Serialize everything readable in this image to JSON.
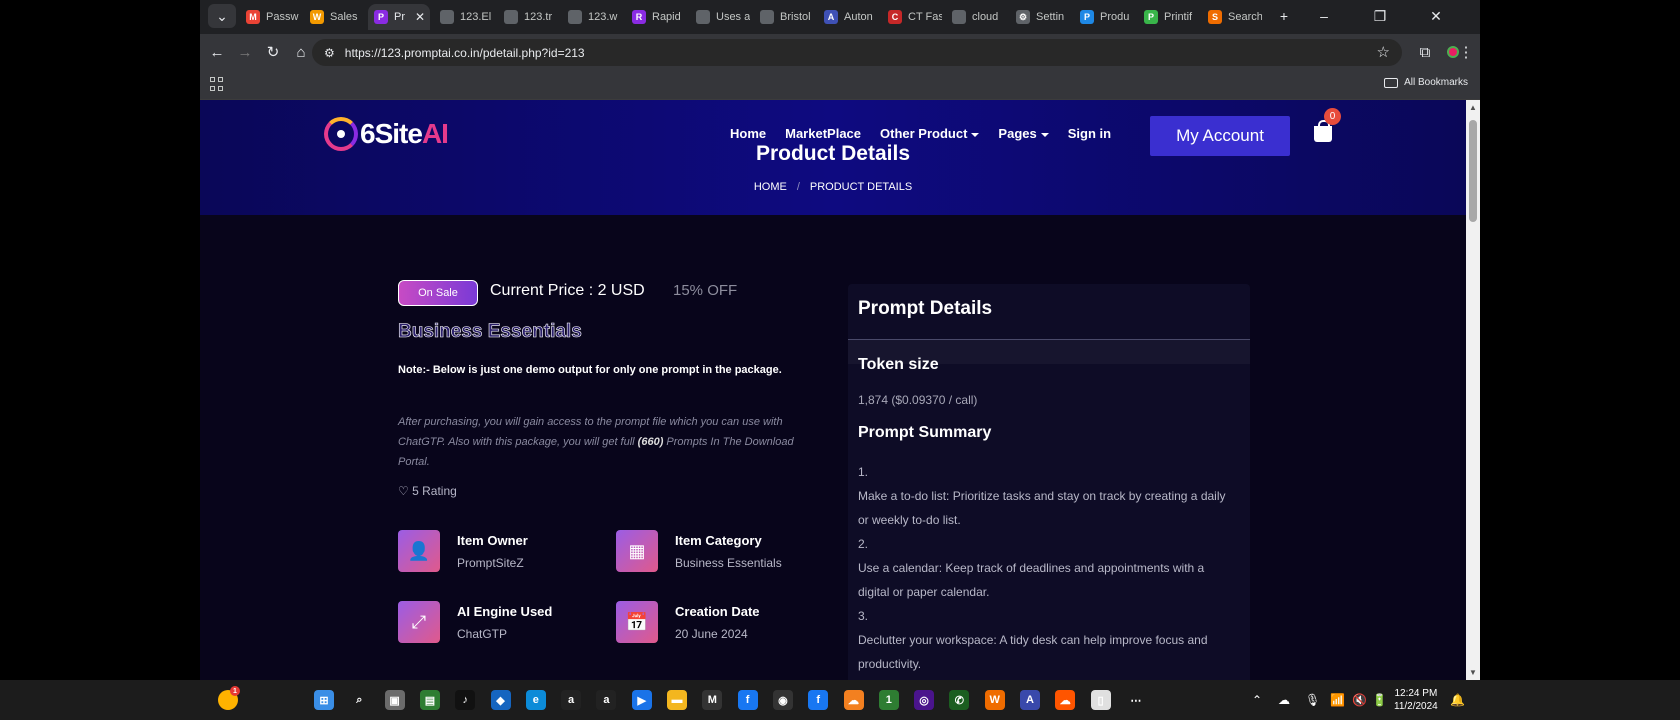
{
  "browser": {
    "tabs": [
      {
        "label": "Passw",
        "icon": "gmail-icon",
        "color": "#ea4335",
        "glyph": "M"
      },
      {
        "label": "Sales",
        "icon": "w-icon",
        "color": "#f29900",
        "glyph": "W"
      },
      {
        "label": "Pr",
        "icon": "promptai-icon",
        "color": "#8a2be2",
        "glyph": "P",
        "active": true
      },
      {
        "label": "123.El",
        "icon": "globe-icon",
        "color": "#5f6368",
        "glyph": ""
      },
      {
        "label": "123.tr",
        "icon": "globe-icon",
        "color": "#5f6368",
        "glyph": ""
      },
      {
        "label": "123.w",
        "icon": "globe-icon",
        "color": "#5f6368",
        "glyph": ""
      },
      {
        "label": "Rapid",
        "icon": "rapid-icon",
        "color": "#8a2be2",
        "glyph": "R"
      },
      {
        "label": "Uses a",
        "icon": "globe-icon",
        "color": "#5f6368",
        "glyph": ""
      },
      {
        "label": "Bristol",
        "icon": "globe-icon",
        "color": "#5f6368",
        "glyph": ""
      },
      {
        "label": "Auton",
        "icon": "auton-icon",
        "color": "#3f51b5",
        "glyph": "A"
      },
      {
        "label": "CT Fas",
        "icon": "ct-icon",
        "color": "#c62828",
        "glyph": "C"
      },
      {
        "label": "cloud",
        "icon": "globe-icon",
        "color": "#5f6368",
        "glyph": ""
      },
      {
        "label": "Settin",
        "icon": "gear-icon",
        "color": "#5f6368",
        "glyph": "⚙"
      },
      {
        "label": "Produ",
        "icon": "product-icon",
        "color": "#1e88e5",
        "glyph": "P"
      },
      {
        "label": "Printif",
        "icon": "printify-icon",
        "color": "#39b54a",
        "glyph": "P"
      },
      {
        "label": "Search",
        "icon": "search-tab-icon",
        "color": "#ef6c00",
        "glyph": "S"
      }
    ],
    "new_tab": "+",
    "url": "https://123.promptai.co.in/pdetail.php?id=213",
    "bookmarks_label": "All Bookmarks"
  },
  "site": {
    "logo_text_a": "6Site",
    "logo_text_b": "AI",
    "nav": [
      {
        "label": "Home",
        "dropdown": false
      },
      {
        "label": "MarketPlace",
        "dropdown": false
      },
      {
        "label": "Other Product",
        "dropdown": true
      },
      {
        "label": "Pages",
        "dropdown": true
      },
      {
        "label": "Sign in",
        "dropdown": false
      }
    ],
    "account_button": "My Account",
    "cart_count": "0",
    "page_title": "Product Details",
    "breadcrumb_home": "HOME",
    "breadcrumb_sep": "/",
    "breadcrumb_current": "PRODUCT DETAILS"
  },
  "product": {
    "sale_badge": "On Sale",
    "current_price": "Current Price : 2 USD",
    "discount": "15% OFF",
    "title": "Business Essentials",
    "note": "Note:- Below is just one demo output for only one prompt in the package.",
    "para_a": "After purchasing, you will gain access to the prompt file which you can use with ChatGTP. Also with this package, you will get full ",
    "para_count": "(660)",
    "para_b": " Prompts In The Download Portal.",
    "rating": "♡ 5 Rating",
    "meta": [
      {
        "label": "Item Owner",
        "value": "PromptSiteZ",
        "icon": "user-icon",
        "glyph": "👤"
      },
      {
        "label": "Item Category",
        "value": "Business Essentials",
        "icon": "grid-icon",
        "glyph": "▦"
      },
      {
        "label": "AI Engine Used",
        "value": "ChatGTP",
        "icon": "expand-icon",
        "glyph": "⤢"
      },
      {
        "label": "Creation Date",
        "value": "20 June 2024",
        "icon": "calendar-icon",
        "glyph": "📅"
      }
    ]
  },
  "details": {
    "heading": "Prompt Details",
    "token_heading": "Token size",
    "token_value": "1,874 ($0.09370 / call)",
    "summary_heading": "Prompt Summary",
    "summary_lines": [
      "1.",
      "Make a to-do list: Prioritize tasks and stay on track by creating a daily or weekly to-do list.",
      "2.",
      "Use a calendar: Keep track of deadlines and appointments with a digital or paper calendar.",
      "3.",
      "Declutter your workspace: A tidy desk can help improve focus and productivity."
    ]
  },
  "taskbar": {
    "apps": [
      {
        "name": "start-icon",
        "color": "#3a8ee6",
        "glyph": "⊞"
      },
      {
        "name": "search-icon",
        "color": "transparent",
        "glyph": "⌕"
      },
      {
        "name": "task-view-icon",
        "color": "#6b6b6b",
        "glyph": "▣"
      },
      {
        "name": "store-icon",
        "color": "#2e7d32",
        "glyph": "▤"
      },
      {
        "name": "tiktok-icon",
        "color": "#111",
        "glyph": "♪"
      },
      {
        "name": "folder-app-icon",
        "color": "#1565c0",
        "glyph": "◆"
      },
      {
        "name": "edge-icon",
        "color": "#0c8bd8",
        "glyph": "e"
      },
      {
        "name": "amazon-icon",
        "color": "#222",
        "glyph": "a"
      },
      {
        "name": "amazon-music-icon",
        "color": "#222",
        "glyph": "a"
      },
      {
        "name": "prime-video-icon",
        "color": "#1a73e8",
        "glyph": "▶"
      },
      {
        "name": "file-explorer-icon",
        "color": "#f3b61f",
        "glyph": "▬"
      },
      {
        "name": "m-app-icon",
        "color": "#333",
        "glyph": "M"
      },
      {
        "name": "facebook-icon",
        "color": "#1877f2",
        "glyph": "f"
      },
      {
        "name": "github-icon",
        "color": "#333",
        "glyph": "◉"
      },
      {
        "name": "facebook-2-icon",
        "color": "#1877f2",
        "glyph": "f"
      },
      {
        "name": "cloudflare-icon",
        "color": "#f38020",
        "glyph": "☁"
      },
      {
        "name": "one-icon",
        "color": "#2e7d32",
        "glyph": "1"
      },
      {
        "name": "game-icon",
        "color": "#4a148c",
        "glyph": "◎"
      },
      {
        "name": "phone-icon",
        "color": "#1b5e20",
        "glyph": "✆"
      },
      {
        "name": "wp-icon",
        "color": "#ef6c00",
        "glyph": "W"
      },
      {
        "name": "a-app-icon",
        "color": "#3949ab",
        "glyph": "A"
      },
      {
        "name": "soundcloud-icon",
        "color": "#ff5500",
        "glyph": "☁"
      },
      {
        "name": "notepad-icon",
        "color": "#e0e0e0",
        "glyph": "▯"
      },
      {
        "name": "more-icon",
        "color": "transparent",
        "glyph": "⋯"
      }
    ],
    "notify_badge": "1",
    "time": "12:24 PM",
    "date": "11/2/2024"
  }
}
